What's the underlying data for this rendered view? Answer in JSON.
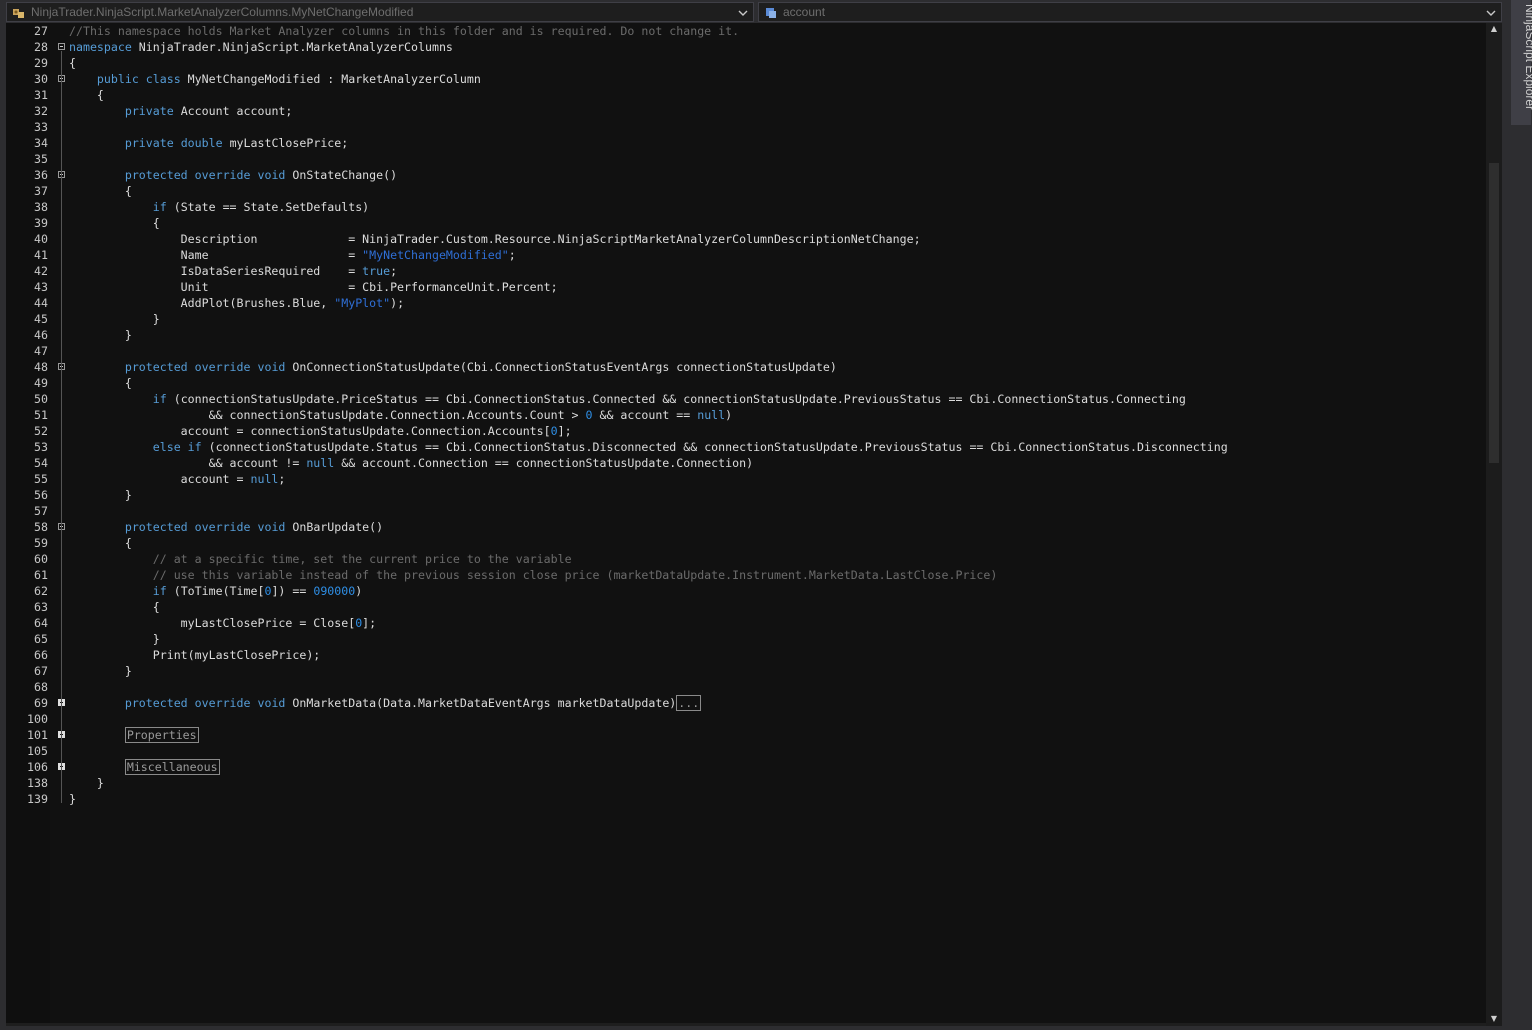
{
  "nav": {
    "type_dropdown": "NinjaTrader.NinjaScript.MarketAnalyzerColumns.MyNetChangeModified",
    "member_dropdown": "account"
  },
  "side_panel": {
    "label": "NinjaScript Explorer"
  },
  "editor": {
    "line_numbers": [
      "27",
      "28",
      "29",
      "30",
      "31",
      "32",
      "33",
      "34",
      "35",
      "36",
      "37",
      "38",
      "39",
      "40",
      "41",
      "42",
      "43",
      "44",
      "45",
      "46",
      "47",
      "48",
      "49",
      "50",
      "51",
      "52",
      "53",
      "54",
      "55",
      "56",
      "57",
      "58",
      "59",
      "60",
      "61",
      "62",
      "63",
      "64",
      "65",
      "66",
      "67",
      "68",
      "69",
      "100",
      "101",
      "105",
      "106",
      "138",
      "139"
    ],
    "tokens": {
      "l27": "//This namespace holds Market Analyzer columns in this folder and is required. Do not change it.",
      "l28a": "namespace",
      "l28b": " NinjaTrader.NinjaScript.MarketAnalyzerColumns",
      "l29": "{",
      "l30a": "    ",
      "l30b": "public",
      "l30c": " ",
      "l30d": "class",
      "l30e": " MyNetChangeModified : MarketAnalyzerColumn",
      "l31": "    {",
      "l32a": "        ",
      "l32b": "private",
      "l32c": " Account account;",
      "l34a": "        ",
      "l34b": "private",
      "l34c": " ",
      "l34d": "double",
      "l34e": " myLastClosePrice;",
      "l36a": "        ",
      "l36b": "protected",
      "l36c": " ",
      "l36d": "override",
      "l36e": " ",
      "l36f": "void",
      "l36g": " OnStateChange()",
      "l37": "        {",
      "l38a": "            ",
      "l38b": "if",
      "l38c": " (State == State.SetDefaults)",
      "l39": "            {",
      "l40": "                Description             = NinjaTrader.Custom.Resource.NinjaScriptMarketAnalyzerColumnDescriptionNetChange;",
      "l41a": "                Name                    = ",
      "l41b": "\"MyNetChangeModified\"",
      "l41c": ";",
      "l42a": "                IsDataSeriesRequired    = ",
      "l42b": "true",
      "l42c": ";",
      "l43": "                Unit                    = Cbi.PerformanceUnit.Percent;",
      "l44a": "                AddPlot(Brushes.Blue, ",
      "l44b": "\"MyPlot\"",
      "l44c": ");",
      "l45": "            }",
      "l46": "        }",
      "l48a": "        ",
      "l48b": "protected",
      "l48c": " ",
      "l48d": "override",
      "l48e": " ",
      "l48f": "void",
      "l48g": " OnConnectionStatusUpdate(Cbi.ConnectionStatusEventArgs connectionStatusUpdate)",
      "l49": "        {",
      "l50a": "            ",
      "l50b": "if",
      "l50c": " (connectionStatusUpdate.PriceStatus == Cbi.ConnectionStatus.Connected && connectionStatusUpdate.PreviousStatus == Cbi.ConnectionStatus.Connecting",
      "l51a": "                    && connectionStatusUpdate.Connection.Accounts.Count > ",
      "l51b": "0",
      "l51c": " && account == ",
      "l51d": "null",
      "l51e": ")",
      "l52a": "                account = connectionStatusUpdate.Connection.Accounts[",
      "l52b": "0",
      "l52c": "];",
      "l53a": "            ",
      "l53b": "else",
      "l53c": " ",
      "l53d": "if",
      "l53e": " (connectionStatusUpdate.Status == Cbi.ConnectionStatus.Disconnected && connectionStatusUpdate.PreviousStatus == Cbi.ConnectionStatus.Disconnecting",
      "l54a": "                    && account != ",
      "l54b": "null",
      "l54c": " && account.Connection == connectionStatusUpdate.Connection)",
      "l55a": "                account = ",
      "l55b": "null",
      "l55c": ";",
      "l56": "        }",
      "l58a": "        ",
      "l58b": "protected",
      "l58c": " ",
      "l58d": "override",
      "l58e": " ",
      "l58f": "void",
      "l58g": " OnBarUpdate()",
      "l59": "        {",
      "l60": "            // at a specific time, set the current price to the variable",
      "l61": "            // use this variable instead of the previous session close price (marketDataUpdate.Instrument.MarketData.LastClose.Price)",
      "l62a": "            ",
      "l62b": "if",
      "l62c": " (ToTime(Time[",
      "l62d": "0",
      "l62e": "]) == ",
      "l62f": "090000",
      "l62g": ")",
      "l63": "            {",
      "l64a": "                myLastClosePrice = Close[",
      "l64b": "0",
      "l64c": "];",
      "l65": "            }",
      "l66": "            Print(myLastClosePrice);",
      "l67": "        }",
      "l69a": "        ",
      "l69b": "protected",
      "l69c": " ",
      "l69d": "override",
      "l69e": " ",
      "l69f": "void",
      "l69g": " OnMarketData(Data.MarketDataEventArgs marketDataUpdate)",
      "l69h": "...",
      "l101a": "        ",
      "l101b": "Properties",
      "l106a": "        ",
      "l106b": "Miscellaneous",
      "l138": "    }",
      "l139": "}"
    }
  },
  "colors": {
    "background": "#111111",
    "keyword": "#569cd6",
    "string": "#2f6fd6",
    "comment": "#6b6b6b",
    "text": "#dcdcdc"
  }
}
